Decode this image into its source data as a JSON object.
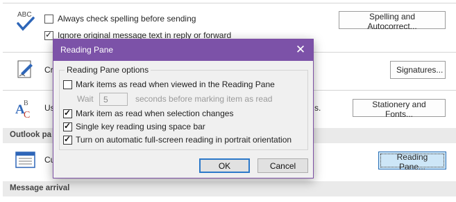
{
  "options_page": {
    "row1_text": "Always check spelling before sending",
    "row2_text": "Ignore original message text in reply or forward",
    "row1_checked": false,
    "row2_checked": true,
    "row3_text_fragment": "Cr",
    "row4_text_fragment": "Us",
    "row4_trailing": "s.",
    "row5_text_fragment": "Cu",
    "spelling_button": "Spelling and Autocorrect...",
    "signatures_button": "Signatures...",
    "stationery_button": "Stationery and Fonts...",
    "reading_pane_button": "Reading Pane...",
    "section_outlook_panes": "Outlook pa",
    "section_message_arrival": "Message arrival",
    "spelling_icon_text": "ABC",
    "stationery_icon_text": "AC"
  },
  "dialog": {
    "title": "Reading Pane",
    "close_glyph": "✕",
    "group_label": "Reading Pane options",
    "options": [
      {
        "label": "Mark items as read when viewed in the Reading Pane",
        "checked": false
      },
      {
        "label": "Mark item as read when selection changes",
        "checked": true
      },
      {
        "label": "Single key reading using space bar",
        "checked": true
      },
      {
        "label": "Turn on automatic full-screen reading in portrait orientation",
        "checked": true
      }
    ],
    "wait_label": "Wait",
    "wait_value": "5",
    "wait_suffix": "seconds before marking item as read",
    "ok_label": "OK",
    "cancel_label": "Cancel"
  },
  "colors": {
    "dialog_title_bg": "#7c52a8",
    "active_button_bg": "#cde6f7",
    "default_button_border": "#2b78c9"
  }
}
